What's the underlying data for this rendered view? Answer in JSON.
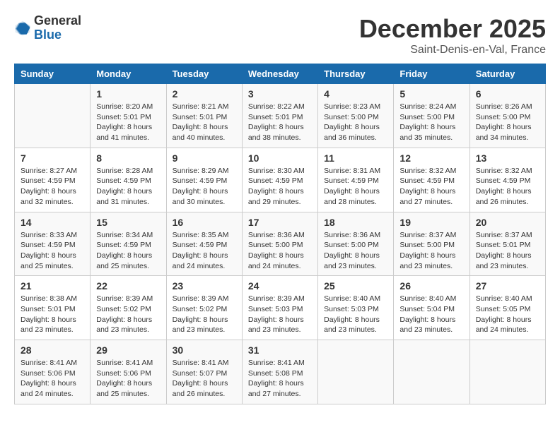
{
  "header": {
    "logo_general": "General",
    "logo_blue": "Blue",
    "month": "December 2025",
    "location": "Saint-Denis-en-Val, France"
  },
  "days_of_week": [
    "Sunday",
    "Monday",
    "Tuesday",
    "Wednesday",
    "Thursday",
    "Friday",
    "Saturday"
  ],
  "weeks": [
    [
      {
        "day": "",
        "info": ""
      },
      {
        "day": "1",
        "info": "Sunrise: 8:20 AM\nSunset: 5:01 PM\nDaylight: 8 hours\nand 41 minutes."
      },
      {
        "day": "2",
        "info": "Sunrise: 8:21 AM\nSunset: 5:01 PM\nDaylight: 8 hours\nand 40 minutes."
      },
      {
        "day": "3",
        "info": "Sunrise: 8:22 AM\nSunset: 5:01 PM\nDaylight: 8 hours\nand 38 minutes."
      },
      {
        "day": "4",
        "info": "Sunrise: 8:23 AM\nSunset: 5:00 PM\nDaylight: 8 hours\nand 36 minutes."
      },
      {
        "day": "5",
        "info": "Sunrise: 8:24 AM\nSunset: 5:00 PM\nDaylight: 8 hours\nand 35 minutes."
      },
      {
        "day": "6",
        "info": "Sunrise: 8:26 AM\nSunset: 5:00 PM\nDaylight: 8 hours\nand 34 minutes."
      }
    ],
    [
      {
        "day": "7",
        "info": "Sunrise: 8:27 AM\nSunset: 4:59 PM\nDaylight: 8 hours\nand 32 minutes."
      },
      {
        "day": "8",
        "info": "Sunrise: 8:28 AM\nSunset: 4:59 PM\nDaylight: 8 hours\nand 31 minutes."
      },
      {
        "day": "9",
        "info": "Sunrise: 8:29 AM\nSunset: 4:59 PM\nDaylight: 8 hours\nand 30 minutes."
      },
      {
        "day": "10",
        "info": "Sunrise: 8:30 AM\nSunset: 4:59 PM\nDaylight: 8 hours\nand 29 minutes."
      },
      {
        "day": "11",
        "info": "Sunrise: 8:31 AM\nSunset: 4:59 PM\nDaylight: 8 hours\nand 28 minutes."
      },
      {
        "day": "12",
        "info": "Sunrise: 8:32 AM\nSunset: 4:59 PM\nDaylight: 8 hours\nand 27 minutes."
      },
      {
        "day": "13",
        "info": "Sunrise: 8:32 AM\nSunset: 4:59 PM\nDaylight: 8 hours\nand 26 minutes."
      }
    ],
    [
      {
        "day": "14",
        "info": "Sunrise: 8:33 AM\nSunset: 4:59 PM\nDaylight: 8 hours\nand 25 minutes."
      },
      {
        "day": "15",
        "info": "Sunrise: 8:34 AM\nSunset: 4:59 PM\nDaylight: 8 hours\nand 25 minutes."
      },
      {
        "day": "16",
        "info": "Sunrise: 8:35 AM\nSunset: 4:59 PM\nDaylight: 8 hours\nand 24 minutes."
      },
      {
        "day": "17",
        "info": "Sunrise: 8:36 AM\nSunset: 5:00 PM\nDaylight: 8 hours\nand 24 minutes."
      },
      {
        "day": "18",
        "info": "Sunrise: 8:36 AM\nSunset: 5:00 PM\nDaylight: 8 hours\nand 23 minutes."
      },
      {
        "day": "19",
        "info": "Sunrise: 8:37 AM\nSunset: 5:00 PM\nDaylight: 8 hours\nand 23 minutes."
      },
      {
        "day": "20",
        "info": "Sunrise: 8:37 AM\nSunset: 5:01 PM\nDaylight: 8 hours\nand 23 minutes."
      }
    ],
    [
      {
        "day": "21",
        "info": "Sunrise: 8:38 AM\nSunset: 5:01 PM\nDaylight: 8 hours\nand 23 minutes."
      },
      {
        "day": "22",
        "info": "Sunrise: 8:39 AM\nSunset: 5:02 PM\nDaylight: 8 hours\nand 23 minutes."
      },
      {
        "day": "23",
        "info": "Sunrise: 8:39 AM\nSunset: 5:02 PM\nDaylight: 8 hours\nand 23 minutes."
      },
      {
        "day": "24",
        "info": "Sunrise: 8:39 AM\nSunset: 5:03 PM\nDaylight: 8 hours\nand 23 minutes."
      },
      {
        "day": "25",
        "info": "Sunrise: 8:40 AM\nSunset: 5:03 PM\nDaylight: 8 hours\nand 23 minutes."
      },
      {
        "day": "26",
        "info": "Sunrise: 8:40 AM\nSunset: 5:04 PM\nDaylight: 8 hours\nand 23 minutes."
      },
      {
        "day": "27",
        "info": "Sunrise: 8:40 AM\nSunset: 5:05 PM\nDaylight: 8 hours\nand 24 minutes."
      }
    ],
    [
      {
        "day": "28",
        "info": "Sunrise: 8:41 AM\nSunset: 5:06 PM\nDaylight: 8 hours\nand 24 minutes."
      },
      {
        "day": "29",
        "info": "Sunrise: 8:41 AM\nSunset: 5:06 PM\nDaylight: 8 hours\nand 25 minutes."
      },
      {
        "day": "30",
        "info": "Sunrise: 8:41 AM\nSunset: 5:07 PM\nDaylight: 8 hours\nand 26 minutes."
      },
      {
        "day": "31",
        "info": "Sunrise: 8:41 AM\nSunset: 5:08 PM\nDaylight: 8 hours\nand 27 minutes."
      },
      {
        "day": "",
        "info": ""
      },
      {
        "day": "",
        "info": ""
      },
      {
        "day": "",
        "info": ""
      }
    ]
  ]
}
